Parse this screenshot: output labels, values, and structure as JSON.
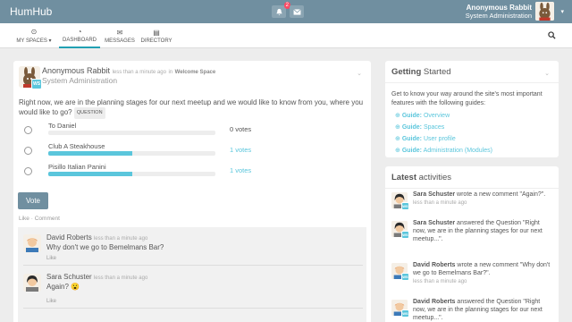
{
  "app": {
    "brand": "HumHub"
  },
  "topbar": {
    "notification_count": "2",
    "user_name": "Anonymous Rabbit",
    "user_role": "System Administration"
  },
  "nav": {
    "items": [
      {
        "label": "MY SPACES ▾",
        "icon": "grid-circle-icon"
      },
      {
        "label": "DASHBOARD",
        "icon": "dashboard-icon"
      },
      {
        "label": "MESSAGES",
        "icon": "envelope-icon"
      },
      {
        "label": "DIRECTORY",
        "icon": "book-icon"
      }
    ]
  },
  "post": {
    "author": "Anonymous Rabbit",
    "time": "less than a minute ago",
    "in_word": "in",
    "space": "Welcome Space",
    "subtitle": "System Administration",
    "avatar_badge": "WS",
    "text": "Right now, we are in the planning stages for our next meetup and we would like to know from you, where you would like to go?",
    "type_badge": "QUESTION",
    "poll": [
      {
        "label": "To Daniel",
        "votes": "0 votes",
        "fraction": 0
      },
      {
        "label": "Club A Steakhouse",
        "votes": "1 votes",
        "fraction": 0.5
      },
      {
        "label": "Pisillo Italian Panini",
        "votes": "1 votes",
        "fraction": 0.5
      }
    ],
    "vote_button": "Vote",
    "like_label": "Like",
    "separator": "·",
    "comment_label": "Comment"
  },
  "comments": [
    {
      "author": "David Roberts",
      "time": "less than a minute ago",
      "text": "Why don't we go to Bemelmans Bar?",
      "like": "Like"
    },
    {
      "author": "Sara Schuster",
      "time": "less than a minute ago",
      "text": "Again? 😮",
      "like": "Like"
    }
  ],
  "getting_started": {
    "title_bold": "Getting",
    "title_rest": "Started",
    "description": "Get to know your way around the site's most important features with the following guides:",
    "guides": [
      {
        "prefix": "Guide:",
        "label": "Overview"
      },
      {
        "prefix": "Guide:",
        "label": "Spaces"
      },
      {
        "prefix": "Guide:",
        "label": "User profile"
      },
      {
        "prefix": "Guide:",
        "label": "Administration (Modules)"
      }
    ]
  },
  "activities": {
    "title_bold": "Latest",
    "title_rest": "activities",
    "items": [
      {
        "user": "Sara Schuster",
        "text": "wrote a new comment \"Again?\".",
        "time": "less than a minute ago"
      },
      {
        "user": "Sara Schuster",
        "text": "answered the Question \"Right now, we are in the planning stages for our next meetup...\".",
        "time": ""
      },
      {
        "user": "David Roberts",
        "text": "wrote a new comment \"Why don't we go to Bemelmans Bar?\".",
        "time": "less than a minute ago"
      },
      {
        "user": "David Roberts",
        "text": "answered the Question \"Right now, we are in the planning stages for our next meetup...\".",
        "time": ""
      }
    ]
  }
}
